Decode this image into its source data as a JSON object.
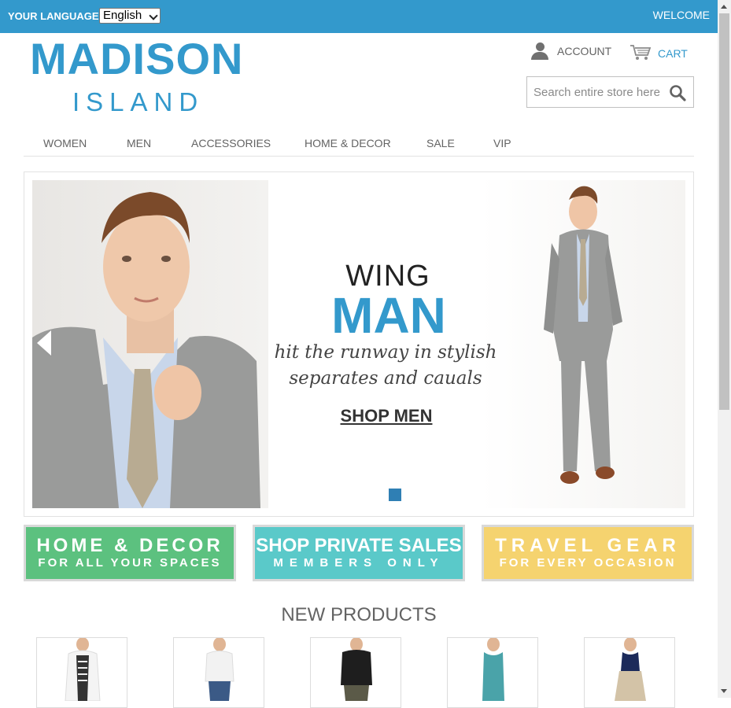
{
  "topbar": {
    "language_label": "YOUR LANGUAGE:",
    "language_selected": "English",
    "welcome": "WELCOME"
  },
  "logo": {
    "main": "MADISON",
    "sub": "ISLAND"
  },
  "header": {
    "account_label": "ACCOUNT",
    "cart_label": "CART",
    "search_placeholder": "Search entire store here..."
  },
  "nav": {
    "items": [
      "WOMEN",
      "MEN",
      "ACCESSORIES",
      "HOME & DECOR",
      "SALE",
      "VIP"
    ]
  },
  "hero": {
    "line1": "WING",
    "line2": "MAN",
    "tagline": "hit the runway in stylish separates and cauals",
    "cta": "SHOP MEN"
  },
  "promos": [
    {
      "line1": "HOME & DECOR",
      "line2": "FOR ALL YOUR SPACES",
      "color": "#5cc17f"
    },
    {
      "line1": "SHOP PRIVATE SALES",
      "line2": "MEMBERS ONLY",
      "color": "#5ac9c9"
    },
    {
      "line1": "TRAVEL GEAR",
      "line2": "FOR EVERY OCCASION",
      "color": "#f5d36f"
    }
  ],
  "new_products": {
    "title": "NEW PRODUCTS"
  },
  "colors": {
    "brand": "#3399cc",
    "text": "#636363"
  }
}
